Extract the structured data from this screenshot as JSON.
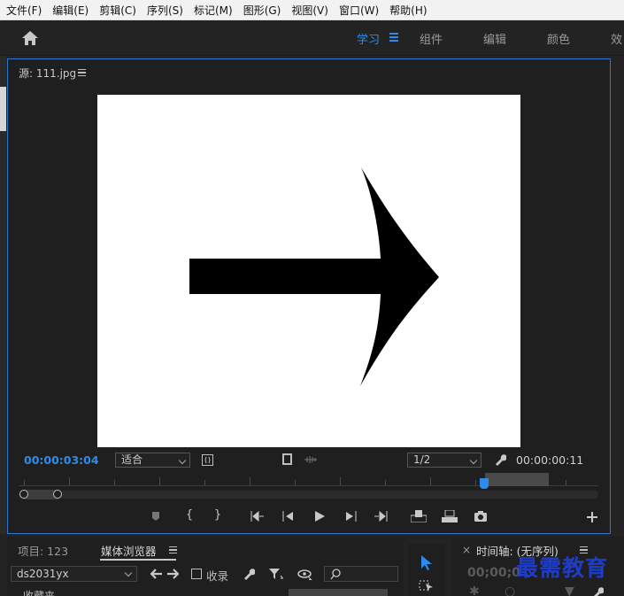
{
  "menu": [
    "文件(F)",
    "编辑(E)",
    "剪辑(C)",
    "序列(S)",
    "标记(M)",
    "图形(G)",
    "视图(V)",
    "窗口(W)",
    "帮助(H)"
  ],
  "workspaces": [
    "学习",
    "组件",
    "编辑",
    "颜色",
    "效"
  ],
  "source_panel": {
    "title": "源: 111.jpg",
    "timecode_current": "00:00:03:04",
    "fit": "适合",
    "resolution": "1/2",
    "timecode_duration": "00:00:00:11"
  },
  "bottom_panel": {
    "tab_project": "项目: 123",
    "tab_media_browser": "媒体浏览器",
    "path": "ds2031yx",
    "favorites_label": "收录",
    "cut_text": "收藏夹"
  },
  "timeline_panel": {
    "title": "时间轴: (无序列)",
    "timecode": "00;00;0"
  },
  "watermark": "最需教育",
  "colors": {
    "accent": "#2d8ceb",
    "watermark": "#1f3cc8"
  }
}
